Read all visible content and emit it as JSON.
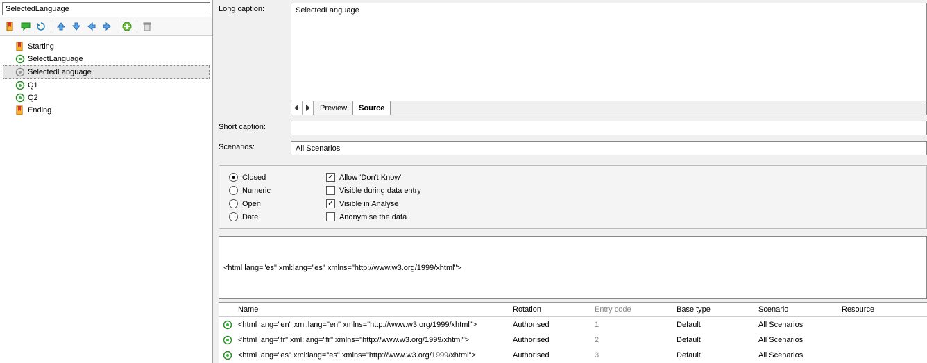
{
  "search": {
    "value": "SelectedLanguage"
  },
  "tree": {
    "items": [
      {
        "label": "Starting",
        "icon": "bookmark",
        "selected": false
      },
      {
        "label": "SelectLanguage",
        "icon": "target",
        "selected": false
      },
      {
        "label": "SelectedLanguage",
        "icon": "target-grey",
        "selected": true
      },
      {
        "label": "Q1",
        "icon": "target",
        "selected": false
      },
      {
        "label": "Q2",
        "icon": "target",
        "selected": false
      },
      {
        "label": "Ending",
        "icon": "bookmark",
        "selected": false
      }
    ]
  },
  "form": {
    "longCaptionLabel": "Long caption:",
    "longCaptionValue": "SelectedLanguage",
    "shortCaptionLabel": "Short caption:",
    "shortCaptionValue": "",
    "scenariosLabel": "Scenarios:",
    "scenariosValue": "All Scenarios",
    "tabs": {
      "preview": "Preview",
      "source": "Source"
    }
  },
  "questionType": {
    "closed": "Closed",
    "numeric": "Numeric",
    "open": "Open",
    "date": "Date",
    "allowDK": "Allow 'Don't Know'",
    "visibleEntry": "Visible during data entry",
    "visibleAnalyse": "Visible in Analyse",
    "anonymise": "Anonymise the data"
  },
  "filterValue": "<html lang=\"es\" xml:lang=\"es\" xmlns=\"http://www.w3.org/1999/xhtml\">",
  "table": {
    "headers": {
      "name": "Name",
      "rotation": "Rotation",
      "entry": "Entry code",
      "base": "Base type",
      "scenario": "Scenario",
      "resource": "Resource"
    },
    "rows": [
      {
        "name": "<html lang=\"en\" xml:lang=\"en\" xmlns=\"http://www.w3.org/1999/xhtml\">",
        "rotation": "Authorised",
        "entry": "1",
        "base": "Default",
        "scenario": "All Scenarios"
      },
      {
        "name": "<html lang=\"fr\" xml:lang=\"fr\" xmlns=\"http://www.w3.org/1999/xhtml\">",
        "rotation": "Authorised",
        "entry": "2",
        "base": "Default",
        "scenario": "All Scenarios"
      },
      {
        "name": "<html lang=\"es\" xml:lang=\"es\" xmlns=\"http://www.w3.org/1999/xhtml\">",
        "rotation": "Authorised",
        "entry": "3",
        "base": "Default",
        "scenario": "All Scenarios"
      }
    ]
  }
}
